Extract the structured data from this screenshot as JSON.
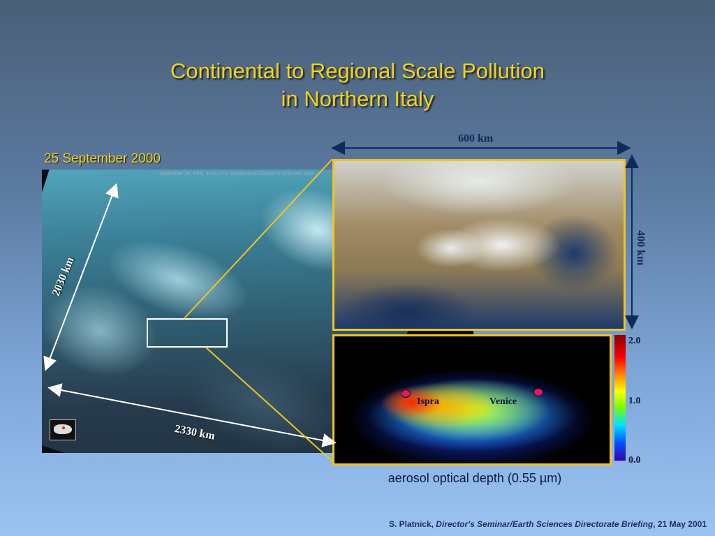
{
  "slide": {
    "title_line1": "Continental to Regional Scale Pollution",
    "title_line2": "in Northern Italy",
    "date": "25 September 2000",
    "sat_header": "September 26, 2000, 1015 UTC   MOD021KM.A2000270.1015.002.2000...",
    "dims": {
      "width_km": "2330 km",
      "height_km": "2030 km",
      "inset_width": "600 km",
      "inset_height": "400 km"
    },
    "aod": {
      "city1": "Ispra",
      "city2": "Venice",
      "cb_max": "2.0",
      "cb_mid": "1.0",
      "cb_min": "0.0",
      "caption": "aerosol optical depth (0.55 µm)"
    },
    "footer": {
      "author": "S. Platnick, ",
      "event": "Director's Seminar/Earth Sciences Directorate Briefing",
      "date": ",  21 May 2001"
    },
    "colors": {
      "title": "#f2d21e",
      "frame": "#f2c420",
      "marker": "#e0146a"
    }
  }
}
